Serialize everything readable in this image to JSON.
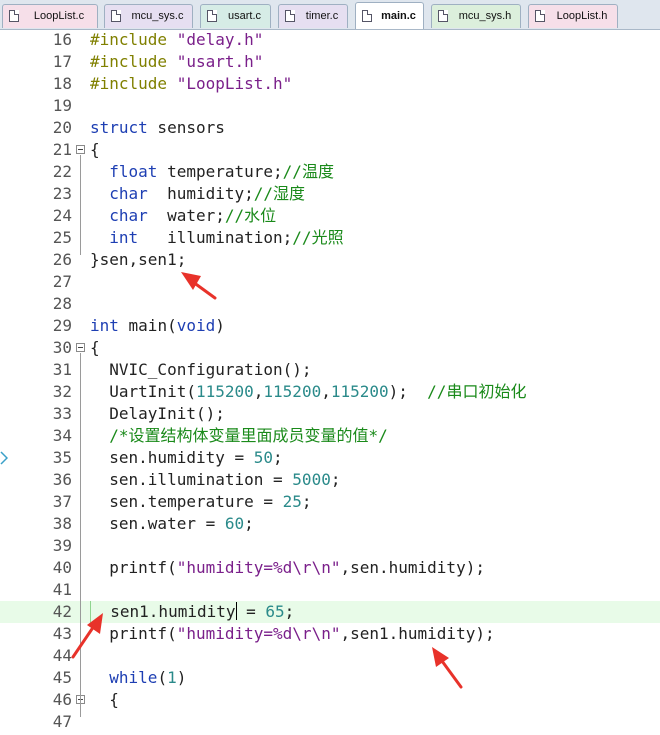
{
  "tabs": [
    {
      "label": "LoopList.c",
      "color": "#f6dfe9"
    },
    {
      "label": "mcu_sys.c",
      "color": "#e6dff1"
    },
    {
      "label": "usart.c",
      "color": "#d6ece6"
    },
    {
      "label": "timer.c",
      "color": "#e6dff1"
    },
    {
      "label": "main.c",
      "color": "#ffffff",
      "active": true
    },
    {
      "label": "mcu_sys.h",
      "color": "#dcefdc"
    },
    {
      "label": "LoopList.h",
      "color": "#f6dfe9"
    }
  ],
  "lines": [
    {
      "n": "16",
      "tokens": [
        [
          "pre",
          "#include "
        ],
        [
          "str",
          "\"delay.h\""
        ]
      ]
    },
    {
      "n": "17",
      "tokens": [
        [
          "pre",
          "#include "
        ],
        [
          "str",
          "\"usart.h\""
        ]
      ]
    },
    {
      "n": "18",
      "tokens": [
        [
          "pre",
          "#include "
        ],
        [
          "str",
          "\"LoopList.h\""
        ]
      ]
    },
    {
      "n": "19",
      "tokens": []
    },
    {
      "n": "20",
      "tokens": [
        [
          "kw",
          "struct"
        ],
        [
          "plain",
          " sensors"
        ]
      ]
    },
    {
      "n": "21",
      "fold": true,
      "tokens": [
        [
          "plain",
          "{"
        ]
      ]
    },
    {
      "n": "22",
      "tokens": [
        [
          "plain",
          "  "
        ],
        [
          "kw",
          "float"
        ],
        [
          "plain",
          " temperature;"
        ],
        [
          "com",
          "//温度"
        ]
      ]
    },
    {
      "n": "23",
      "tokens": [
        [
          "plain",
          "  "
        ],
        [
          "kw",
          "char"
        ],
        [
          "plain",
          "  humidity;"
        ],
        [
          "com",
          "//湿度"
        ]
      ]
    },
    {
      "n": "24",
      "tokens": [
        [
          "plain",
          "  "
        ],
        [
          "kw",
          "char"
        ],
        [
          "plain",
          "  water;"
        ],
        [
          "com",
          "//水位"
        ]
      ]
    },
    {
      "n": "25",
      "tokens": [
        [
          "plain",
          "  "
        ],
        [
          "kw",
          "int"
        ],
        [
          "plain",
          "   illumination;"
        ],
        [
          "com",
          "//光照"
        ]
      ]
    },
    {
      "n": "26",
      "tokens": [
        [
          "plain",
          "}sen,sen1;"
        ]
      ]
    },
    {
      "n": "27",
      "tokens": []
    },
    {
      "n": "28",
      "tokens": []
    },
    {
      "n": "29",
      "tokens": [
        [
          "kw",
          "int"
        ],
        [
          "plain",
          " main("
        ],
        [
          "kw",
          "void"
        ],
        [
          "plain",
          ")"
        ]
      ]
    },
    {
      "n": "30",
      "fold": true,
      "tokens": [
        [
          "plain",
          "{"
        ]
      ]
    },
    {
      "n": "31",
      "tokens": [
        [
          "plain",
          "  NVIC_Configuration();"
        ]
      ]
    },
    {
      "n": "32",
      "tokens": [
        [
          "plain",
          "  UartInit("
        ],
        [
          "num",
          "115200"
        ],
        [
          "plain",
          ","
        ],
        [
          "num",
          "115200"
        ],
        [
          "plain",
          ","
        ],
        [
          "num",
          "115200"
        ],
        [
          "plain",
          ");  "
        ],
        [
          "com",
          "//串口初始化"
        ]
      ]
    },
    {
      "n": "33",
      "tokens": [
        [
          "plain",
          "  DelayInit();"
        ]
      ]
    },
    {
      "n": "34",
      "tokens": [
        [
          "plain",
          "  "
        ],
        [
          "com",
          "/*设置结构体变量里面成员变量的值*/"
        ]
      ]
    },
    {
      "n": "35",
      "tokens": [
        [
          "plain",
          "  sen.humidity = "
        ],
        [
          "num",
          "50"
        ],
        [
          "plain",
          ";"
        ]
      ]
    },
    {
      "n": "36",
      "tokens": [
        [
          "plain",
          "  sen.illumination = "
        ],
        [
          "num",
          "5000"
        ],
        [
          "plain",
          ";"
        ]
      ]
    },
    {
      "n": "37",
      "tokens": [
        [
          "plain",
          "  sen.temperature = "
        ],
        [
          "num",
          "25"
        ],
        [
          "plain",
          ";"
        ]
      ]
    },
    {
      "n": "38",
      "tokens": [
        [
          "plain",
          "  sen.water = "
        ],
        [
          "num",
          "60"
        ],
        [
          "plain",
          ";"
        ]
      ]
    },
    {
      "n": "39",
      "tokens": []
    },
    {
      "n": "40",
      "tokens": [
        [
          "plain",
          "  printf("
        ],
        [
          "str",
          "\"humidity=%d\\r\\n\""
        ],
        [
          "plain",
          ",sen.humidity);"
        ]
      ]
    },
    {
      "n": "41",
      "tokens": []
    },
    {
      "n": "42",
      "current": true,
      "tokens": [
        [
          "plain",
          "  sen1.humidity"
        ],
        [
          "caret",
          ""
        ],
        [
          "plain",
          " = "
        ],
        [
          "num",
          "65"
        ],
        [
          "plain",
          ";"
        ]
      ]
    },
    {
      "n": "43",
      "tokens": [
        [
          "plain",
          "  printf("
        ],
        [
          "str",
          "\"humidity=%d\\r\\n\""
        ],
        [
          "plain",
          ",sen1.humidity);"
        ]
      ]
    },
    {
      "n": "44",
      "tokens": []
    },
    {
      "n": "45",
      "tokens": [
        [
          "plain",
          "  "
        ],
        [
          "kw",
          "while"
        ],
        [
          "plain",
          "("
        ],
        [
          "num",
          "1"
        ],
        [
          "plain",
          ")"
        ]
      ]
    },
    {
      "n": "46",
      "fold": true,
      "tokens": [
        [
          "plain",
          "  {"
        ]
      ]
    },
    {
      "n": "47",
      "tokens": []
    }
  ],
  "colors": {
    "keyword": "#1e3fb3",
    "preprocessor": "#808000",
    "string": "#7a1f8a",
    "comment": "#1a8a1a",
    "number": "#2a8a8a",
    "annotation_arrow": "#e8322a",
    "current_line_bg": "#e8fbe8"
  },
  "annotations": {
    "icon": "red-arrow-icon",
    "count": 3
  }
}
